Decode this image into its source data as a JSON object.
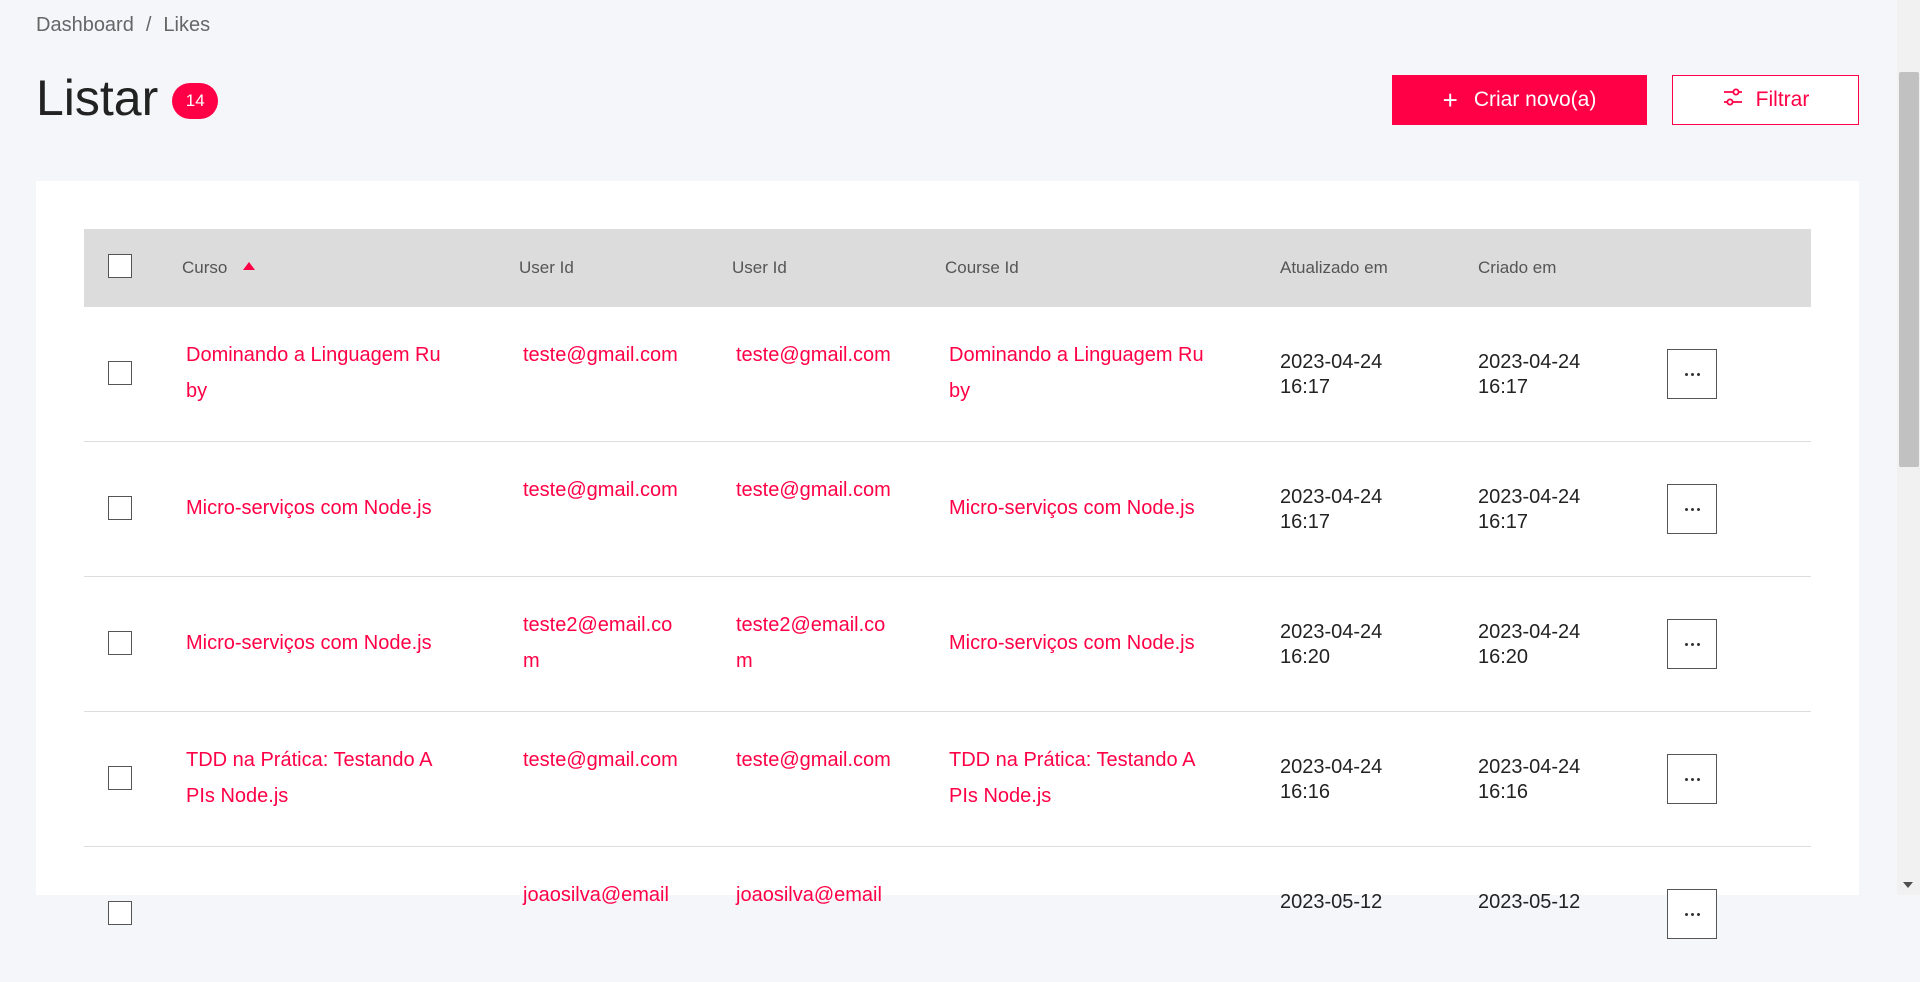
{
  "breadcrumb": {
    "home": "Dashboard",
    "separator": "/",
    "current": "Likes"
  },
  "page": {
    "title": "Listar",
    "count": "14"
  },
  "actions": {
    "create_label": "Criar novo(a)",
    "create_icon": "+",
    "filter_label": "Filtrar"
  },
  "colors": {
    "accent": "#ff0046",
    "header_bg": "#dcdcdc",
    "page_bg": "#f5f6fa"
  },
  "table": {
    "columns": [
      "Curso",
      "User Id",
      "User Id",
      "Course Id",
      "Atualizado em",
      "Criado em"
    ],
    "sort": {
      "column": "Curso",
      "direction": "asc"
    },
    "rows": [
      {
        "curso": "Dominando a Linguagem Ruby",
        "user_id_1": "teste@gmail.com",
        "user_id_2": "teste@gmail.com",
        "course_id": "Dominando a Linguagem Ruby",
        "updated_date": "2023-04-24",
        "updated_time": "16:17",
        "created_date": "2023-04-24",
        "created_time": "16:17"
      },
      {
        "curso": "Micro-serviços com Node.js",
        "user_id_1": "teste@gmail.com",
        "user_id_2": "teste@gmail.com",
        "course_id": "Micro-serviços com Node.js",
        "updated_date": "2023-04-24",
        "updated_time": "16:17",
        "created_date": "2023-04-24",
        "created_time": "16:17"
      },
      {
        "curso": "Micro-serviços com Node.js",
        "user_id_1": "teste2@email.com",
        "user_id_2": "teste2@email.com",
        "course_id": "Micro-serviços com Node.js",
        "updated_date": "2023-04-24",
        "updated_time": "16:20",
        "created_date": "2023-04-24",
        "created_time": "16:20"
      },
      {
        "curso": "TDD na Prática: Testando APIs Node.js",
        "user_id_1": "teste@gmail.com",
        "user_id_2": "teste@gmail.com",
        "course_id": "TDD na Prática: Testando APIs Node.js",
        "updated_date": "2023-04-24",
        "updated_time": "16:16",
        "created_date": "2023-04-24",
        "created_time": "16:16"
      },
      {
        "curso": "",
        "user_id_1": "joaosilva@email",
        "user_id_2": "joaosilva@email",
        "course_id": "",
        "updated_date": "2023-05-12",
        "updated_time": "",
        "created_date": "2023-05-12",
        "created_time": ""
      }
    ]
  }
}
